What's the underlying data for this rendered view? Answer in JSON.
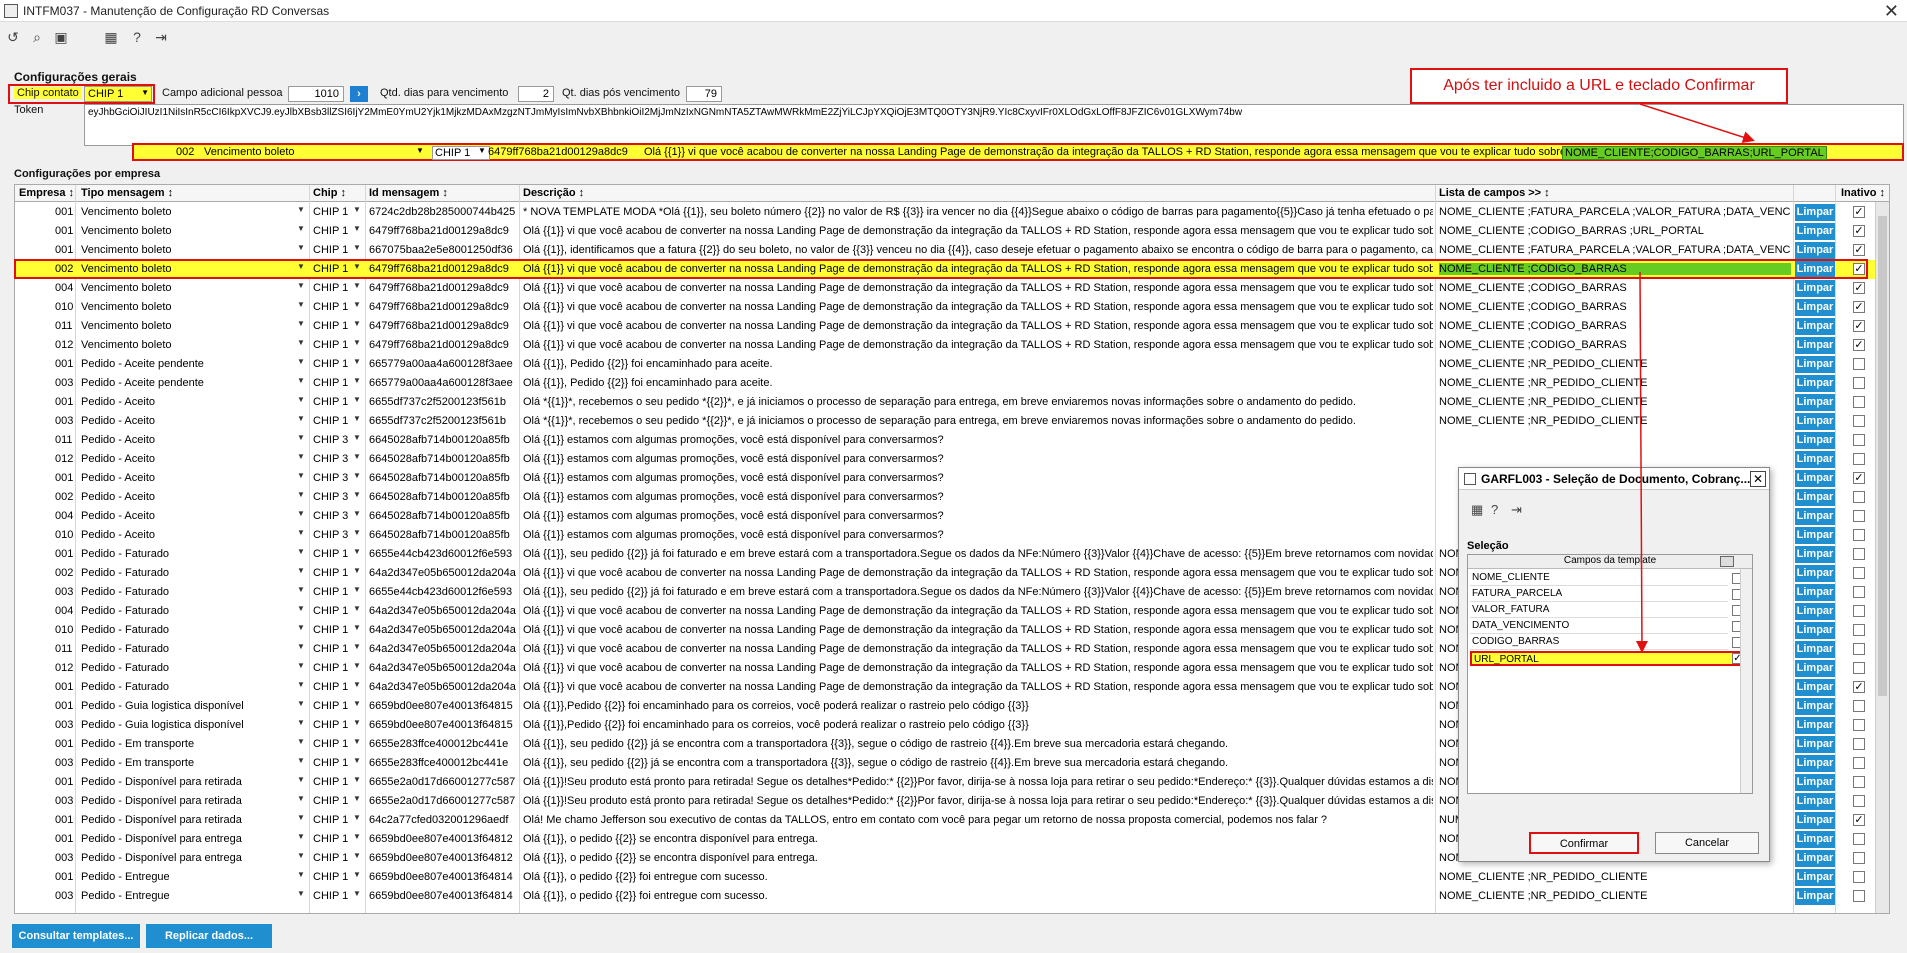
{
  "window": {
    "title": "INTFM037 - Manutenção de Configuração RD Conversas"
  },
  "toolbar": {
    "icons": [
      "refresh-icon",
      "search-icon",
      "save-icon",
      "calendar-icon",
      "help-icon",
      "exit-icon"
    ]
  },
  "general": {
    "section_title": "Configurações gerais",
    "chip_label": "Chip contato",
    "chip_value": "CHIP 1",
    "campo_label": "Campo adicional pessoa",
    "campo_value": "1010",
    "qtd_dias_label": "Qtd. dias para vencimento",
    "qtd_dias_value": "2",
    "qt_pos_label": "Qt. dias pós vencimento",
    "qt_pos_value": "79",
    "token_label": "Token",
    "token_value": "eyJhbGciOiJIUzI1NiIsInR5cCI6IkpXVCJ9.eyJlbXBsb3llZSI6IjY2MmE0YmU2Yjk1MjkzMDAxMzgzNTJmMyIsImNvbXBhbnkiOiI2MjJmNzIxNGNmNTA5ZTAwMWRkMmE2ZjYiLCJpYXQiOjE3MTQ0OTY3NjR9.YIc8CxyvIFr0XLOdGxLOffF8JFZIC6v01GLXWym74bw"
  },
  "annotation": {
    "text": "Após ter incluido a URL e teclado Confirmar"
  },
  "edit_row": {
    "empresa": "002",
    "tipo": "Vencimento boleto",
    "chip": "CHIP 1",
    "id": "6479ff768ba21d00129a8dc9",
    "descricao": "Olá {{1}} vi que você acabou de converter na nossa Landing Page de demonstração da integração da TALLOS + RD Station, responde agora essa mensagem que vou te explicar tudo sobre",
    "campos": "NOME_CLIENTE;CODIGO_BARRAS;URL_PORTAL"
  },
  "grid": {
    "section_title": "Configurações por empresa",
    "headers": {
      "empresa": "Empresa ↕",
      "tipo": "Tipo mensagem ↕",
      "chip": "Chip ↕",
      "id": "Id mensagem ↕",
      "desc": "Descrição ↕",
      "campos": "Lista de campos >> ↕",
      "inativo": "Inativo ↕"
    },
    "limpar_label": "Limpar",
    "rows": [
      {
        "e": "001",
        "t": "Vencimento boleto",
        "c": "CHIP 1",
        "id": "6724c2db28b285000744b425",
        "d": "* NOVA TEMPLATE MODA *Olá {{1}}, seu boleto número {{2}} no valor de R$ {{3}} ira vencer no dia {{4}}Segue abaixo o código de barras para pagamento{{5}}Caso já tenha efetuado o pagamento",
        "l": "NOME_CLIENTE ;FATURA_PARCELA ;VALOR_FATURA ;DATA_VENCIMENTO",
        "x": true
      },
      {
        "e": "001",
        "t": "Vencimento boleto",
        "c": "CHIP 1",
        "id": "6479ff768ba21d00129a8dc9",
        "d": "Olá {{1}} vi que você acabou de converter na nossa Landing Page de demonstração da integração da TALLOS + RD Station, responde agora essa mensagem que vou te explicar tudo sobre",
        "l": "NOME_CLIENTE ;CODIGO_BARRAS ;URL_PORTAL",
        "x": true
      },
      {
        "e": "001",
        "t": "Vencimento boleto",
        "c": "CHIP 1",
        "id": "667075baa2e5e8001250df36",
        "d": "Olá {{1}}, identificamos que a fatura {{2}} do seu boleto, no valor de {{3}} venceu no dia {{4}}, caso deseje efetuar o pagamento abaixo se encontra o código de barra para o pagamento, caso",
        "l": "NOME_CLIENTE ;FATURA_PARCELA ;VALOR_FATURA ;DATA_VENCIMENTO",
        "x": true
      },
      {
        "e": "002",
        "t": "Vencimento boleto",
        "c": "CHIP 1",
        "id": "6479ff768ba21d00129a8dc9",
        "d": "Olá {{1}} vi que você acabou de converter na nossa Landing Page de demonstração da integração da TALLOS + RD Station, responde agora essa mensagem que vou te explicar tudo sobre",
        "l": "NOME_CLIENTE ;CODIGO_BARRAS",
        "x": true
      },
      {
        "e": "004",
        "t": "Vencimento boleto",
        "c": "CHIP 1",
        "id": "6479ff768ba21d00129a8dc9",
        "d": "Olá {{1}} vi que você acabou de converter na nossa Landing Page de demonstração da integração da TALLOS + RD Station, responde agora essa mensagem que vou te explicar tudo sobre",
        "l": "NOME_CLIENTE ;CODIGO_BARRAS",
        "x": true
      },
      {
        "e": "010",
        "t": "Vencimento boleto",
        "c": "CHIP 1",
        "id": "6479ff768ba21d00129a8dc9",
        "d": "Olá {{1}} vi que você acabou de converter na nossa Landing Page de demonstração da integração da TALLOS + RD Station, responde agora essa mensagem que vou te explicar tudo sobre",
        "l": "NOME_CLIENTE ;CODIGO_BARRAS",
        "x": true
      },
      {
        "e": "011",
        "t": "Vencimento boleto",
        "c": "CHIP 1",
        "id": "6479ff768ba21d00129a8dc9",
        "d": "Olá {{1}} vi que você acabou de converter na nossa Landing Page de demonstração da integração da TALLOS + RD Station, responde agora essa mensagem que vou te explicar tudo sobre",
        "l": "NOME_CLIENTE ;CODIGO_BARRAS",
        "x": true
      },
      {
        "e": "012",
        "t": "Vencimento boleto",
        "c": "CHIP 1",
        "id": "6479ff768ba21d00129a8dc9",
        "d": "Olá {{1}} vi que você acabou de converter na nossa Landing Page de demonstração da integração da TALLOS + RD Station, responde agora essa mensagem que vou te explicar tudo sobre",
        "l": "NOME_CLIENTE ;CODIGO_BARRAS",
        "x": true
      },
      {
        "e": "001",
        "t": "Pedido - Aceite pendente",
        "c": "CHIP 1",
        "id": "665779a00aa4a600128f3aee",
        "d": "Olá {{1}}, Pedido {{2}} foi encaminhado para aceite.",
        "l": "NOME_CLIENTE ;NR_PEDIDO_CLIENTE",
        "x": false
      },
      {
        "e": "003",
        "t": "Pedido - Aceite pendente",
        "c": "CHIP 1",
        "id": "665779a00aa4a600128f3aee",
        "d": "Olá {{1}}, Pedido {{2}} foi encaminhado para aceite.",
        "l": "NOME_CLIENTE ;NR_PEDIDO_CLIENTE",
        "x": false
      },
      {
        "e": "001",
        "t": "Pedido - Aceito",
        "c": "CHIP 1",
        "id": "6655df737c2f5200123f561b",
        "d": "Olá *{{1}}*, recebemos o seu pedido *{{2}}*, e já iniciamos o processo de separação para entrega, em breve enviaremos novas informações sobre o andamento do pedido.",
        "l": "NOME_CLIENTE ;NR_PEDIDO_CLIENTE",
        "x": false
      },
      {
        "e": "003",
        "t": "Pedido - Aceito",
        "c": "CHIP 1",
        "id": "6655df737c2f5200123f561b",
        "d": "Olá *{{1}}*, recebemos o seu pedido *{{2}}*, e já iniciamos o processo de separação para entrega, em breve enviaremos novas informações sobre o andamento do pedido.",
        "l": "NOME_CLIENTE ;NR_PEDIDO_CLIENTE",
        "x": false
      },
      {
        "e": "011",
        "t": "Pedido - Aceito",
        "c": "CHIP 3",
        "id": "6645028afb714b00120a85fb",
        "d": "Olá {{1}} estamos com algumas promoções, você está disponível para conversarmos?",
        "l": "",
        "x": false
      },
      {
        "e": "012",
        "t": "Pedido - Aceito",
        "c": "CHIP 3",
        "id": "6645028afb714b00120a85fb",
        "d": "Olá {{1}} estamos com algumas promoções, você está disponível para conversarmos?",
        "l": "",
        "x": false
      },
      {
        "e": "001",
        "t": "Pedido - Aceito",
        "c": "CHIP 3",
        "id": "6645028afb714b00120a85fb",
        "d": "Olá {{1}} estamos com algumas promoções, você está disponível para conversarmos?",
        "l": "",
        "x": true
      },
      {
        "e": "002",
        "t": "Pedido - Aceito",
        "c": "CHIP 3",
        "id": "6645028afb714b00120a85fb",
        "d": "Olá {{1}} estamos com algumas promoções, você está disponível para conversarmos?",
        "l": "",
        "x": false
      },
      {
        "e": "004",
        "t": "Pedido - Aceito",
        "c": "CHIP 3",
        "id": "6645028afb714b00120a85fb",
        "d": "Olá {{1}} estamos com algumas promoções, você está disponível para conversarmos?",
        "l": "",
        "x": false
      },
      {
        "e": "010",
        "t": "Pedido - Aceito",
        "c": "CHIP 3",
        "id": "6645028afb714b00120a85fb",
        "d": "Olá {{1}} estamos com algumas promoções, você está disponível para conversarmos?",
        "l": "",
        "x": false
      },
      {
        "e": "001",
        "t": "Pedido - Faturado",
        "c": "CHIP 1",
        "id": "6655e44cb423d60012f6e593",
        "d": "Olá {{1}}, seu pedido {{2}} já foi faturado e em breve estará com a transportadora.Segue os dados da NFe:Número {{3}}Valor {{4}}Chave de acesso: {{5}}Em breve retornamos com novidade",
        "l": "NOM",
        "x": false
      },
      {
        "e": "002",
        "t": "Pedido - Faturado",
        "c": "CHIP 1",
        "id": "64a2d347e05b650012da204a",
        "d": "Olá {{1}} vi que você acabou de converter na nossa Landing Page de demonstração da integração da TALLOS + RD Station, responde agora essa mensagem que vou te explicar tudo sobre",
        "l": "NOM",
        "x": false
      },
      {
        "e": "003",
        "t": "Pedido - Faturado",
        "c": "CHIP 1",
        "id": "6655e44cb423d60012f6e593",
        "d": "Olá {{1}}, seu pedido {{2}} já foi faturado e em breve estará com a transportadora.Segue os dados da NFe:Número {{3}}Valor {{4}}Chave de acesso: {{5}}Em breve retornamos com novidade",
        "l": "NOM",
        "x": false
      },
      {
        "e": "004",
        "t": "Pedido - Faturado",
        "c": "CHIP 1",
        "id": "64a2d347e05b650012da204a",
        "d": "Olá {{1}} vi que você acabou de converter na nossa Landing Page de demonstração da integração da TALLOS + RD Station, responde agora essa mensagem que vou te explicar tudo sobre",
        "l": "NOM",
        "x": false
      },
      {
        "e": "010",
        "t": "Pedido - Faturado",
        "c": "CHIP 1",
        "id": "64a2d347e05b650012da204a",
        "d": "Olá {{1}} vi que você acabou de converter na nossa Landing Page de demonstração da integração da TALLOS + RD Station, responde agora essa mensagem que vou te explicar tudo sobre",
        "l": "NOM",
        "x": false
      },
      {
        "e": "011",
        "t": "Pedido - Faturado",
        "c": "CHIP 1",
        "id": "64a2d347e05b650012da204a",
        "d": "Olá {{1}} vi que você acabou de converter na nossa Landing Page de demonstração da integração da TALLOS + RD Station, responde agora essa mensagem que vou te explicar tudo sobre",
        "l": "NOM",
        "x": false
      },
      {
        "e": "012",
        "t": "Pedido - Faturado",
        "c": "CHIP 1",
        "id": "64a2d347e05b650012da204a",
        "d": "Olá {{1}} vi que você acabou de converter na nossa Landing Page de demonstração da integração da TALLOS + RD Station, responde agora essa mensagem que vou te explicar tudo sobre",
        "l": "NOM",
        "x": false
      },
      {
        "e": "001",
        "t": "Pedido - Faturado",
        "c": "CHIP 1",
        "id": "64a2d347e05b650012da204a",
        "d": "Olá {{1}} vi que você acabou de converter na nossa Landing Page de demonstração da integração da TALLOS + RD Station, responde agora essa mensagem que vou te explicar tudo sobre",
        "l": "NOM",
        "x": true
      },
      {
        "e": "001",
        "t": "Pedido - Guia logistica disponível",
        "c": "CHIP 1",
        "id": "6659bd0ee807e40013f64815",
        "d": "Olá {{1}},Pedido {{2}} foi encaminhado para os correios, você poderá realizar o rastreio pelo código {{3}}",
        "l": "NOM",
        "x": false
      },
      {
        "e": "003",
        "t": "Pedido - Guia logistica disponível",
        "c": "CHIP 1",
        "id": "6659bd0ee807e40013f64815",
        "d": "Olá {{1}},Pedido {{2}} foi encaminhado para os correios, você poderá realizar o rastreio pelo código {{3}}",
        "l": "NOM",
        "x": false
      },
      {
        "e": "001",
        "t": "Pedido - Em transporte",
        "c": "CHIP 1",
        "id": "6655e283ffce400012bc441e",
        "d": "Olá {{1}}, seu pedido {{2}} já se encontra com a transportadora {{3}}, segue o código de rastreio {{4}}.Em breve sua mercadoria estará chegando.",
        "l": "NOM",
        "x": false
      },
      {
        "e": "003",
        "t": "Pedido - Em transporte",
        "c": "CHIP 1",
        "id": "6655e283ffce400012bc441e",
        "d": "Olá {{1}}, seu pedido {{2}} já se encontra com a transportadora {{3}}, segue o código de rastreio {{4}}.Em breve sua mercadoria estará chegando.",
        "l": "NOM",
        "x": false
      },
      {
        "e": "001",
        "t": "Pedido - Disponível para retirada",
        "c": "CHIP 1",
        "id": "6655e2a0d17d66001277c587",
        "d": "Olá {{1}}!Seu produto está pronto para retirada! Segue os detalhes*Pedido:* {{2}}Por favor, dirija-se à nossa loja para retirar o seu pedido:*Endereço:* {{3}}.Qualquer dúvidas estamos a dispo",
        "l": "NOM",
        "x": false
      },
      {
        "e": "003",
        "t": "Pedido - Disponível para retirada",
        "c": "CHIP 1",
        "id": "6655e2a0d17d66001277c587",
        "d": "Olá {{1}}!Seu produto está pronto para retirada! Segue os detalhes*Pedido:* {{2}}Por favor, dirija-se à nossa loja para retirar o seu pedido:*Endereço:* {{3}}.Qualquer dúvidas estamos a dispo",
        "l": "NOM",
        "x": false
      },
      {
        "e": "001",
        "t": "Pedido - Disponível para retirada",
        "c": "CHIP 1",
        "id": "64c2a77cfed032001296aedf",
        "d": "Olá!  Me chamo Jefferson sou executivo de contas da TALLOS, entro em contato com você para pegar um retorno de nossa proposta comercial, podemos nos falar ?",
        "l": "NUM",
        "x": true
      },
      {
        "e": "001",
        "t": "Pedido - Disponível para entrega",
        "c": "CHIP 1",
        "id": "6659bd0ee807e40013f64812",
        "d": "Olá {{1}}, o pedido {{2}} se encontra disponível para entrega.",
        "l": "NOM",
        "x": false
      },
      {
        "e": "003",
        "t": "Pedido - Disponível para entrega",
        "c": "CHIP 1",
        "id": "6659bd0ee807e40013f64812",
        "d": "Olá {{1}}, o pedido {{2}} se encontra disponível para entrega.",
        "l": "NOM",
        "x": false
      },
      {
        "e": "001",
        "t": "Pedido - Entregue",
        "c": "CHIP 1",
        "id": "6659bd0ee807e40013f64814",
        "d": "Olá {{1}}, o pedido {{2}} foi entregue com sucesso.",
        "l": "NOME_CLIENTE ;NR_PEDIDO_CLIENTE",
        "x": false
      },
      {
        "e": "003",
        "t": "Pedido - Entregue",
        "c": "CHIP 1",
        "id": "6659bd0ee807e40013f64814",
        "d": "Olá {{1}}, o pedido {{2}} foi entregue com sucesso.",
        "l": "NOME_CLIENTE ;NR_PEDIDO_CLIENTE",
        "x": false
      }
    ]
  },
  "dialog": {
    "title": "GARFL003 - Seleção de Documento, Cobranç...",
    "section": "Seleção",
    "list_header": "Campos da template",
    "items": [
      {
        "label": "NOME_CLIENTE",
        "checked": false
      },
      {
        "label": "FATURA_PARCELA",
        "checked": false
      },
      {
        "label": "VALOR_FATURA",
        "checked": false
      },
      {
        "label": "DATA_VENCIMENTO",
        "checked": false
      },
      {
        "label": "CODIGO_BARRAS",
        "checked": false
      },
      {
        "label": "URL_PORTAL",
        "checked": true
      }
    ],
    "confirm_label": "Confirmar",
    "cancel_label": "Cancelar"
  },
  "footer": {
    "consultar_label": "Consultar templates...",
    "replicar_label": "Replicar dados..."
  },
  "colors": {
    "accent": "#1f8fd0",
    "highlight": "#ffff33",
    "green": "#66cc22",
    "annotation": "#e01010"
  }
}
